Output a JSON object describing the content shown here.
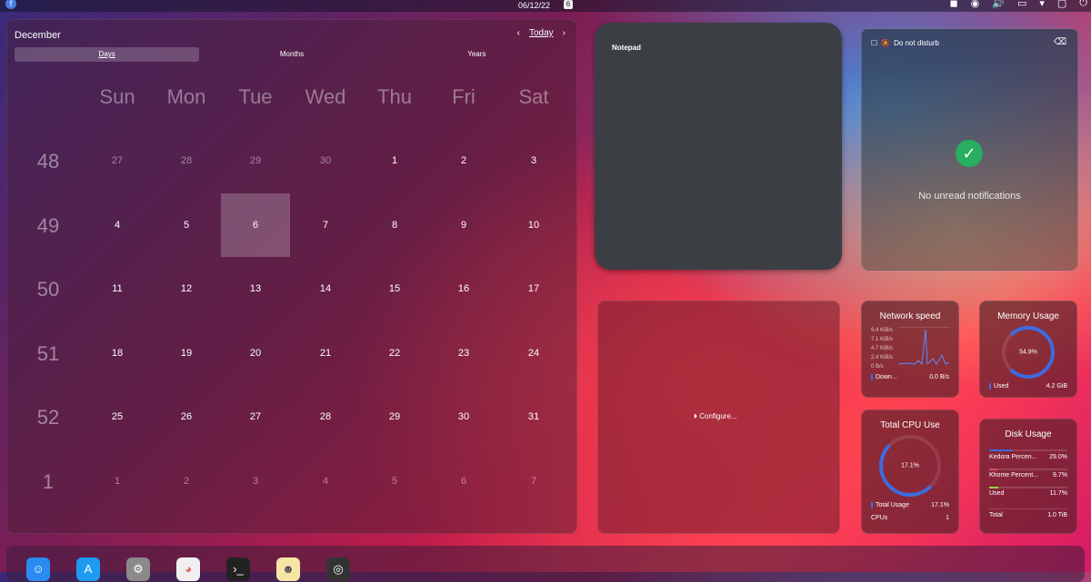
{
  "topbar": {
    "date": "06/12/22",
    "day_badge": "6"
  },
  "calendar": {
    "month": "December",
    "today_label": "Today",
    "tabs": [
      "Days",
      "Months",
      "Years"
    ],
    "weekdays": [
      "Sun",
      "Mon",
      "Tue",
      "Wed",
      "Thu",
      "Fri",
      "Sat"
    ],
    "weeks": [
      {
        "num": "48",
        "days": [
          "27",
          "28",
          "29",
          "30",
          "1",
          "2",
          "3"
        ]
      },
      {
        "num": "49",
        "days": [
          "4",
          "5",
          "6",
          "7",
          "8",
          "9",
          "10"
        ]
      },
      {
        "num": "50",
        "days": [
          "11",
          "12",
          "13",
          "14",
          "15",
          "16",
          "17"
        ]
      },
      {
        "num": "51",
        "days": [
          "18",
          "19",
          "20",
          "21",
          "22",
          "23",
          "24"
        ]
      },
      {
        "num": "52",
        "days": [
          "25",
          "26",
          "27",
          "28",
          "29",
          "30",
          "31"
        ]
      },
      {
        "num": "1",
        "days": [
          "1",
          "2",
          "3",
          "4",
          "5",
          "6",
          "7"
        ]
      }
    ]
  },
  "notepad": {
    "title": "Notepad"
  },
  "notifications": {
    "dnd_label": "Do not disturb",
    "message": "No unread notifications"
  },
  "configure": {
    "label": "Configure..."
  },
  "network": {
    "title": "Network speed",
    "axis": [
      "9.4 KiB/s",
      "7.1 KiB/s",
      "4.7 KiB/s",
      "2.4 KiB/s",
      "0 B/s"
    ],
    "legend_label": "Down...",
    "legend_value": "0.0 B/s"
  },
  "memory": {
    "title": "Memory Usage",
    "percent": "54.9%",
    "used_label": "Used",
    "used_value": "4.2 GiB"
  },
  "cpu": {
    "title": "Total CPU Use",
    "percent": "17.1%",
    "usage_label": "Total Usage",
    "usage_value": "17.1%",
    "cpus_label": "CPUs",
    "cpus_value": "1"
  },
  "disk": {
    "title": "Disk Usage",
    "rows": [
      {
        "label": "Kedora Percen...",
        "value": "29.0%"
      },
      {
        "label": "Khome Percent...",
        "value": "9.7%"
      },
      {
        "label": "Used",
        "value": "11.7%"
      },
      {
        "label": "Total",
        "value": "1.0 TiB"
      }
    ]
  },
  "colors": {
    "accent": "#3d6be0",
    "ok": "#27ae60"
  }
}
